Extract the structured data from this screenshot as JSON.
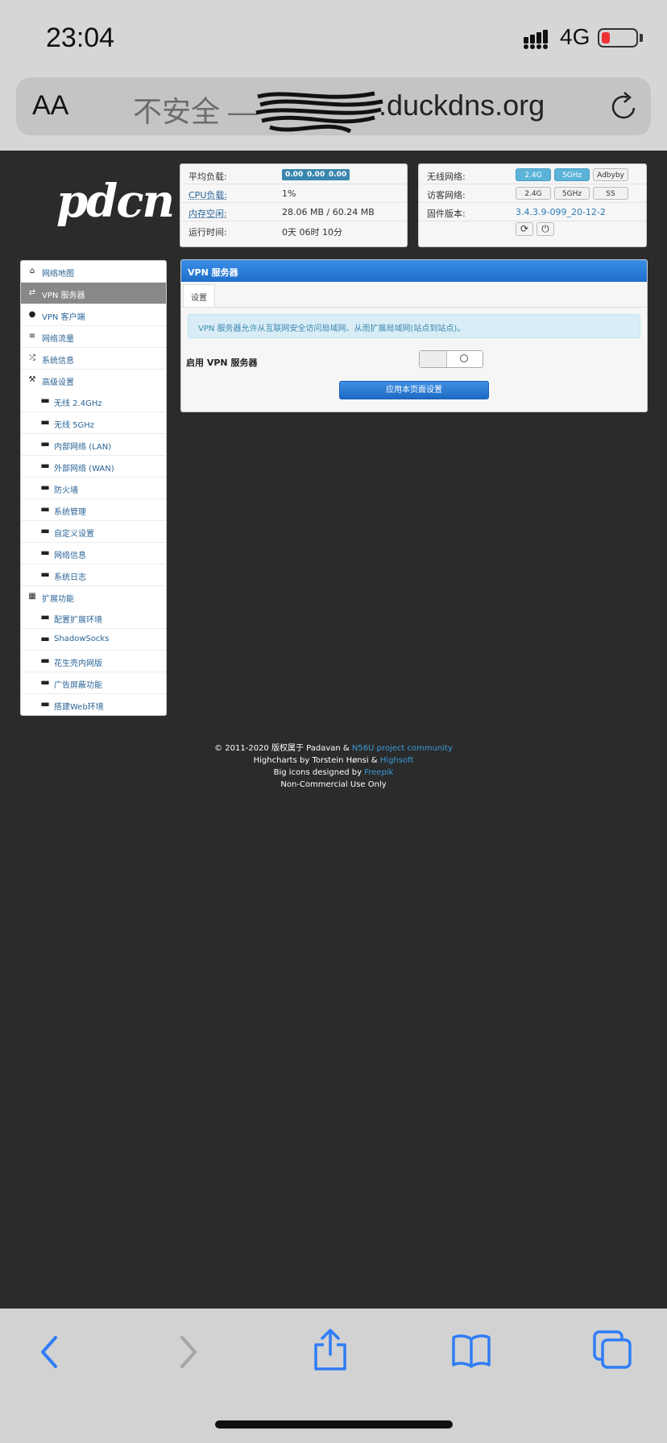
{
  "status_bar": {
    "time": "23:04",
    "network": "4G"
  },
  "browser": {
    "text_size_label": "AA",
    "url_insecure": "不安全 —",
    "url_host": ".duckdns.org"
  },
  "router": {
    "logo": "pdcn",
    "stats": {
      "load_label": "平均负载:",
      "load_values": [
        "0.00",
        "0.00",
        "0.00"
      ],
      "cpu_label": "CPU负载:",
      "cpu_value": "1%",
      "mem_label": "内存空闲:",
      "mem_value": "28.06 MB / 60.24 MB",
      "uptime_label": "运行时间:",
      "uptime_value": "0天 06时 10分"
    },
    "wireless": {
      "wifi_label": "无线网络:",
      "wifi_buttons": [
        "2.4G",
        "5GHz",
        "Adbyby"
      ],
      "guest_label": "访客网络:",
      "guest_buttons": [
        "2.4G",
        "5GHz",
        "SS"
      ],
      "firmware_label": "固件版本:",
      "firmware_value": "3.4.3.9-099_20-12-2",
      "refresh_icon": "⟳",
      "power_icon": "⏻"
    },
    "sidebar": [
      {
        "label": "网络地图",
        "icon": "⌂"
      },
      {
        "label": "VPN 服务器",
        "icon": "⇄"
      },
      {
        "label": "VPN 客户端",
        "icon": "●"
      },
      {
        "label": "网络流量",
        "icon": "≡"
      },
      {
        "label": "系统信息",
        "icon": "⤮"
      },
      {
        "label": "高级设置",
        "icon": "⚒"
      },
      {
        "label": "无线 2.4GHz",
        "icon": "▬"
      },
      {
        "label": "无线 5GHz",
        "icon": "▬"
      },
      {
        "label": "内部网络 (LAN)",
        "icon": "▬"
      },
      {
        "label": "外部网络 (WAN)",
        "icon": "▬"
      },
      {
        "label": "防火墙",
        "icon": "▬"
      },
      {
        "label": "系统管理",
        "icon": "▬"
      },
      {
        "label": "自定义设置",
        "icon": "▬"
      },
      {
        "label": "网络信息",
        "icon": "▬"
      },
      {
        "label": "系统日志",
        "icon": "▬"
      },
      {
        "label": "扩展功能",
        "icon": "▦"
      },
      {
        "label": "配置扩展环境",
        "icon": "▬"
      },
      {
        "label": "ShadowSocks",
        "icon": "▬"
      },
      {
        "label": "花生壳内网版",
        "icon": "▬"
      },
      {
        "label": "广告屏蔽功能",
        "icon": "▬"
      },
      {
        "label": "搭建Web环境",
        "icon": "▬"
      }
    ],
    "vpn": {
      "title": "VPN 服务器",
      "tab": "设置",
      "info": "VPN 服务器允许从互联网安全访问局域网、从而扩展局域网(站点到站点)。",
      "enable_label": "启用 VPN 服务器",
      "enabled": false,
      "apply": "应用本页面设置"
    },
    "footer": {
      "line1_a": "© 2011-2020 版权属于 Padavan & ",
      "line1_link": "N56U project community",
      "line2_a": "Highcharts by Torstein Hønsi & ",
      "line2_link": "Highsoft",
      "line3_a": "Big icons designed by ",
      "line3_link": "Freepik",
      "line4": "Non-Commercial Use Only"
    }
  },
  "colors": {
    "page_bg": "#2b2b2b",
    "accent": "#1e6fcb",
    "link": "#2a6496"
  }
}
